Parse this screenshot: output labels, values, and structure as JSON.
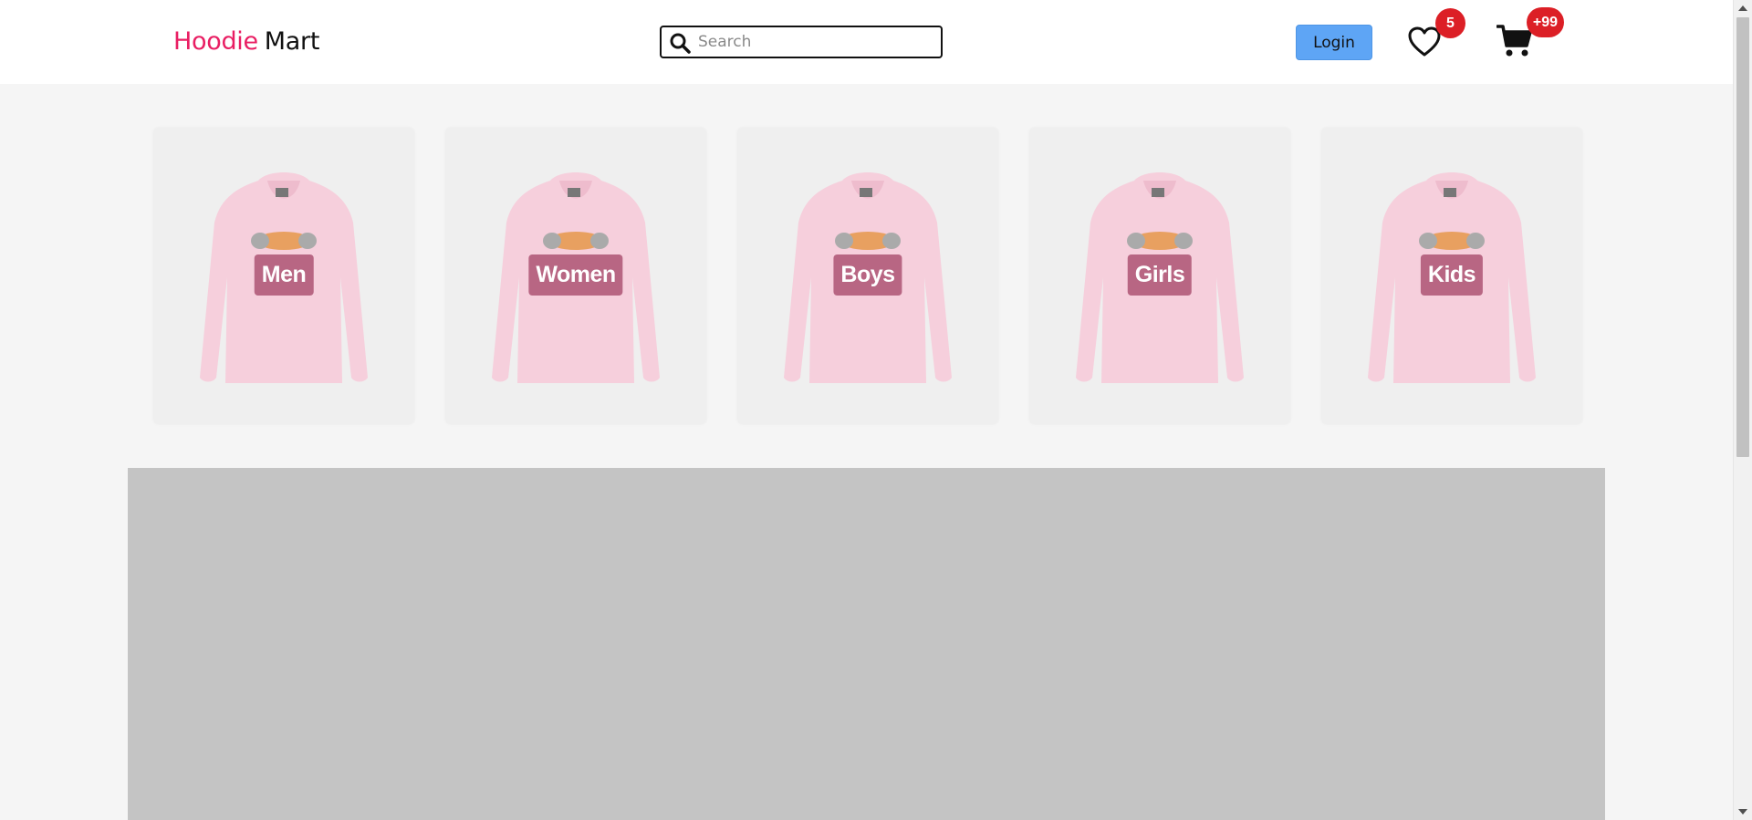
{
  "header": {
    "logo_part1": "Hoodie",
    "logo_part2": "Mart",
    "brand_color": "#e91e63",
    "search_placeholder": "Search",
    "login_label": "Login",
    "wishlist_count": "5",
    "cart_count": "+99",
    "badge_color": "#dc1f26",
    "login_color": "#5ea5f5"
  },
  "categories": [
    {
      "label": "Men",
      "icon": "hoodie-image"
    },
    {
      "label": "Women",
      "icon": "hoodie-image"
    },
    {
      "label": "Boys",
      "icon": "hoodie-image"
    },
    {
      "label": "Girls",
      "icon": "hoodie-image"
    },
    {
      "label": "Kids",
      "icon": "hoodie-image"
    }
  ],
  "label_color": "#b86683",
  "icons": [
    "search-icon",
    "heart-icon",
    "cart-icon"
  ]
}
